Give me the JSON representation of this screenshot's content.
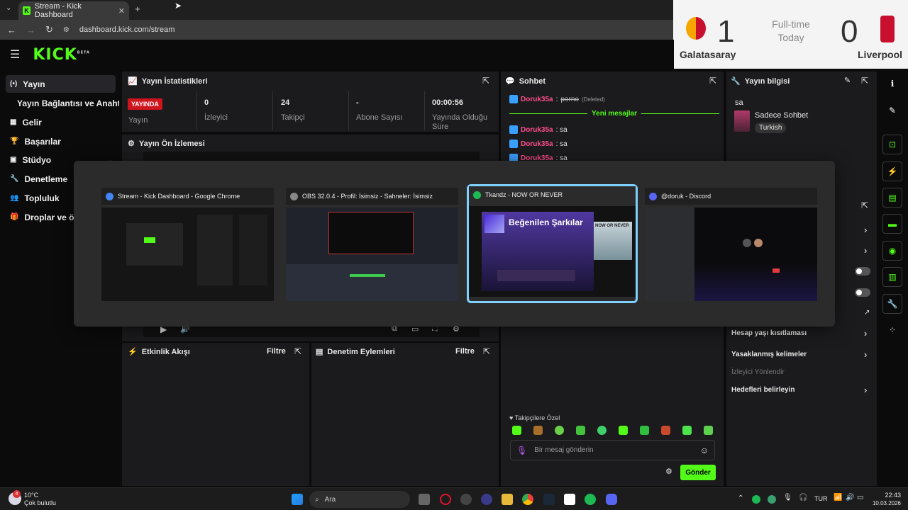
{
  "browser": {
    "tab_title": "Stream - Kick Dashboard",
    "url": "dashboard.kick.com/stream",
    "new_tab": "+",
    "close": "✕"
  },
  "score": {
    "home_team": "Galatasaray",
    "away_team": "Liverpool",
    "home_score": "1",
    "away_score": "0",
    "status": "Full-time",
    "date": "Today"
  },
  "header": {
    "logo": "KICK",
    "beta": "BETA"
  },
  "sidebar": {
    "items": [
      {
        "label": "Yayın",
        "icon": "(•)"
      },
      {
        "label": "Yayın Bağlantısı ve Anahtarı",
        "icon": ""
      },
      {
        "label": "Gelir",
        "icon": "▦"
      },
      {
        "label": "Başarılar",
        "icon": "🏆"
      },
      {
        "label": "Stüdyo",
        "icon": "▣"
      },
      {
        "label": "Denetleme",
        "icon": "🔧"
      },
      {
        "label": "Topluluk",
        "icon": "👥"
      },
      {
        "label": "Droplar ve ödü",
        "icon": "🎁"
      }
    ]
  },
  "stats": {
    "title": "Yayın İstatistikleri",
    "live_badge": "YAYINDA",
    "live_label": "Yayın",
    "viewers": "0",
    "viewers_label": "İzleyici",
    "followers": "24",
    "followers_label": "Takipçi",
    "subs": "-",
    "subs_label": "Abone Sayısı",
    "uptime": "00:00:56",
    "uptime_label_1": "Yayında Olduğu",
    "uptime_label_2": "Süre"
  },
  "preview": {
    "title": "Yayın Ön İzlemesi"
  },
  "chat": {
    "title": "Sohbet",
    "deleted_user": "Doruk35a",
    "deleted_msg": "porno",
    "deleted_tag": "(Deleted)",
    "new_messages": "Yeni mesajlar",
    "lines": [
      {
        "user": "Doruk35a",
        "msg": ": sa"
      },
      {
        "user": "Doruk35a",
        "msg": ": sa"
      },
      {
        "user": "Doruk35a",
        "msg": ": sa"
      }
    ],
    "followers_only": "Takipçilere Özel",
    "input_placeholder": "Bir mesaj gönderin",
    "send": "Gönder"
  },
  "info": {
    "title": "Yayın bilgisi",
    "stream_title": "sa",
    "category": "Sadece Sohbet",
    "language": "Turkish"
  },
  "settings": {
    "rows": [
      {
        "label": "Hesap yaşı kısıtlaması"
      },
      {
        "label": "Yasaklanmış kelimeler"
      },
      {
        "label": "İzleyici Yönlendir",
        "muted": true
      },
      {
        "label": "Hedefleri belirleyin"
      }
    ]
  },
  "activity": {
    "title": "Etkinlik Akışı",
    "filter": "Filtre"
  },
  "mod": {
    "title": "Denetim Eylemleri",
    "filter": "Filtre"
  },
  "switcher": {
    "windows": [
      {
        "title": "Stream - Kick Dashboard - Google Chrome",
        "color": "#4285f4"
      },
      {
        "title": "OBS 32.0.4 - Profil: İsimsiz - Sahneler: İsimsiz",
        "color": "#888888"
      },
      {
        "title": "Tkandz - NOW OR NEVER",
        "color": "#1db954"
      },
      {
        "title": "@doruk - Discord",
        "color": "#5865f2"
      }
    ],
    "spotify_heading": "Beğenilen Şarkılar",
    "spotify_album": "NOW OR NEVER"
  },
  "taskbar": {
    "weather_temp": "10°C",
    "weather_desc": "Çok bulutlu",
    "search": "Ara",
    "lang": "TUR",
    "time": "22:43",
    "date": "10.03.2026",
    "weather_badge": "4"
  },
  "colors": {
    "kick_green": "#53fc18",
    "live_red": "#d0141d",
    "accent_blue": "#7fd1ff"
  }
}
